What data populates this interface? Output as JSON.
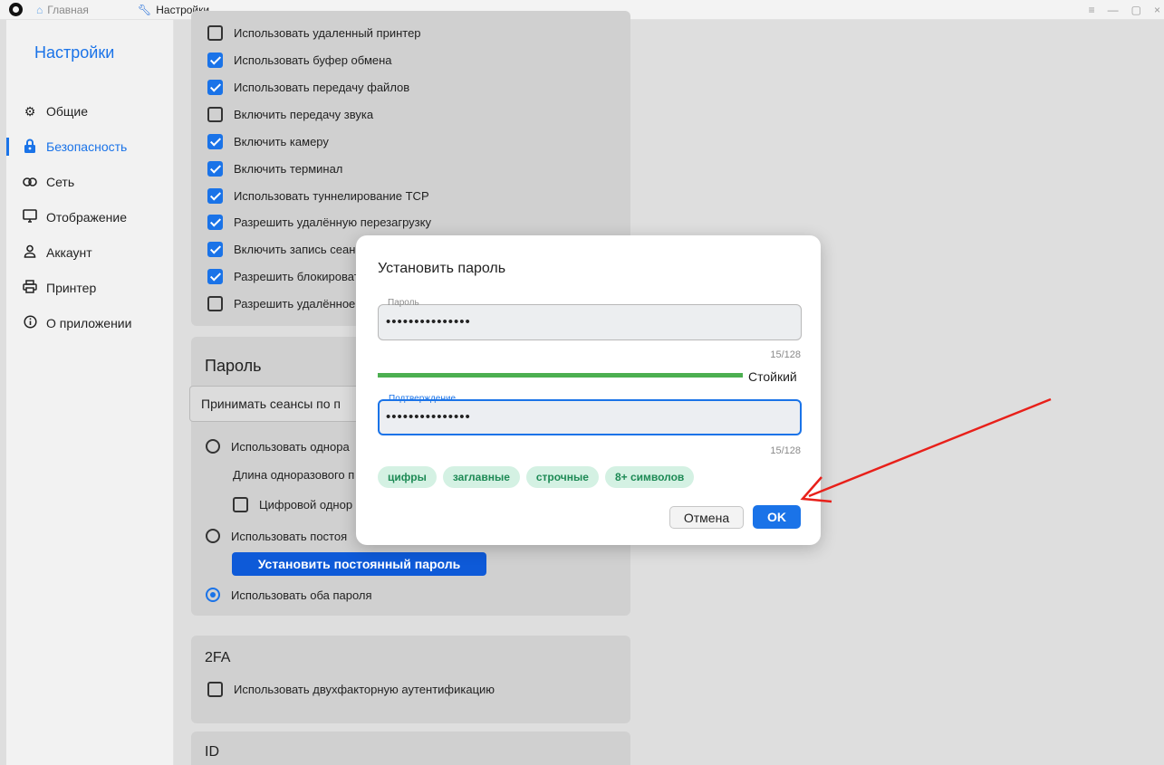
{
  "titlebar": {
    "tabs": [
      {
        "label": "Главная",
        "icon": "home-icon"
      },
      {
        "label": "Настройки",
        "icon": "wrench-icon"
      }
    ],
    "controls": [
      "≡",
      "—",
      "▢",
      "×"
    ]
  },
  "sidebar": {
    "title": "Настройки",
    "items": [
      {
        "label": "Общие",
        "icon": "gear-icon",
        "active": false
      },
      {
        "label": "Безопасность",
        "icon": "lock-icon",
        "active": true
      },
      {
        "label": "Сеть",
        "icon": "link-icon",
        "active": false
      },
      {
        "label": "Отображение",
        "icon": "monitor-icon",
        "active": false
      },
      {
        "label": "Аккаунт",
        "icon": "user-icon",
        "active": false
      },
      {
        "label": "Принтер",
        "icon": "printer-icon",
        "active": false
      },
      {
        "label": "О приложении",
        "icon": "info-icon",
        "active": false
      }
    ]
  },
  "permissions": {
    "items": [
      {
        "label": "Использовать удаленный принтер",
        "checked": false
      },
      {
        "label": "Использовать буфер обмена",
        "checked": true
      },
      {
        "label": "Использовать передачу файлов",
        "checked": true
      },
      {
        "label": "Включить передачу звука",
        "checked": false
      },
      {
        "label": "Включить камеру",
        "checked": true
      },
      {
        "label": "Включить терминал",
        "checked": true
      },
      {
        "label": "Использовать туннелирование TCP",
        "checked": true
      },
      {
        "label": "Разрешить удалённую перезагрузку",
        "checked": true
      },
      {
        "label": "Включить запись сеанс",
        "checked": true
      },
      {
        "label": "Разрешить блокироват",
        "checked": true
      },
      {
        "label": "Разрешить удалённое",
        "checked": false
      }
    ]
  },
  "password_section": {
    "title": "Пароль",
    "dropdown_value": "Принимать сеансы по п",
    "option_one_time": "Использовать однора",
    "one_time_length_label": "Длина одноразового п",
    "digital_one_time": "Цифровой однор",
    "option_permanent": "Использовать постоя",
    "set_permanent_button": "Установить постоянный пароль",
    "option_both": "Использовать оба пароля"
  },
  "twofa_section": {
    "title": "2FA",
    "option": "Использовать двухфакторную аутентификацию"
  },
  "id_section": {
    "title": "ID"
  },
  "dialog": {
    "title": "Установить пароль",
    "password_label": "Пароль",
    "password_value": "•••••••••••••••",
    "password_counter": "15/128",
    "strength": "Стойкий",
    "strength_color": "#4caf50",
    "confirm_label": "Подтверждение",
    "confirm_value": "•••••••••••••••",
    "confirm_counter": "15/128",
    "chips": [
      "цифры",
      "заглавные",
      "строчные",
      "8+ символов"
    ],
    "cancel": "Отмена",
    "ok": "OK"
  },
  "accent_color": "#1a73e8",
  "annotation_color": "#e8201a"
}
